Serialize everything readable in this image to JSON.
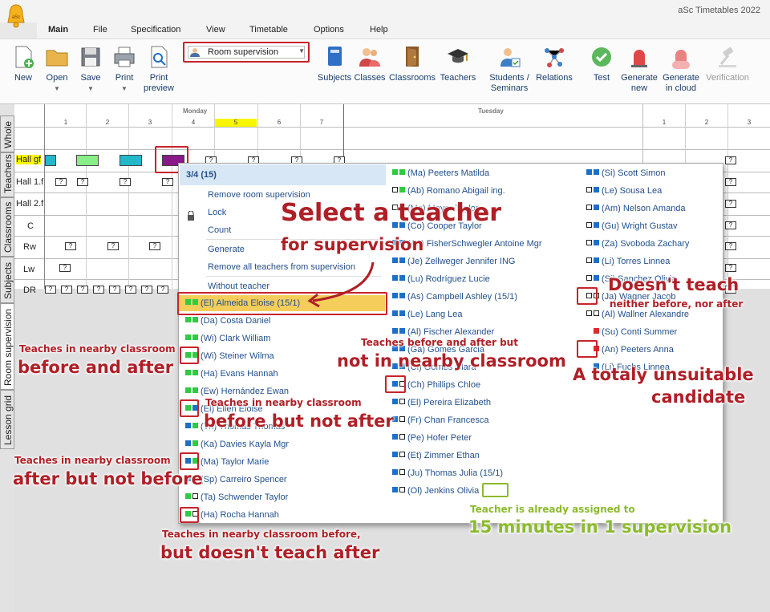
{
  "app": {
    "title": "aSc Timetables 2022"
  },
  "menu": [
    "Main",
    "File",
    "Specification",
    "View",
    "Timetable",
    "Options",
    "Help"
  ],
  "ribbon": {
    "new": "New",
    "open": "Open",
    "save": "Save",
    "print": "Print",
    "print_preview_1": "Print",
    "print_preview_2": "preview",
    "mode_select": "Room supervision",
    "subjects": "Subjects",
    "classes": "Classes",
    "classrooms": "Classrooms",
    "teachers": "Teachers",
    "students_1": "Students /",
    "students_2": "Seminars",
    "relations": "Relations",
    "test": "Test",
    "generate_1": "Generate",
    "generate_2": "new",
    "generate_cloud_1": "Generate",
    "generate_cloud_2": "in cloud",
    "verification": "Verification"
  },
  "vtabs": [
    "Whole",
    "Teachers",
    "Classrooms",
    "Subjects",
    "Room supervision",
    "Lesson grid"
  ],
  "grid": {
    "days": [
      "Monday",
      "Tuesday"
    ],
    "periods": [
      "1",
      "2",
      "3",
      "4",
      "5",
      "6",
      "7",
      "1",
      "2",
      "3"
    ],
    "rows": [
      "Hall gf",
      "Hall 1.f",
      "Hall 2.f",
      "C",
      "Rw",
      "Lw",
      "DR"
    ],
    "cell_mark": "?",
    "cell_colors": [
      "#22b8c8",
      "#88ee88",
      "#22b8c8",
      "#8a188a"
    ]
  },
  "menu_popup": {
    "header": "3/4 (15)",
    "items": [
      "Remove room supervision",
      "Lock",
      "Count",
      "Generate",
      "Remove all teachers from supervision",
      "Without teacher"
    ]
  },
  "teachers_col1": [
    "(El) Almeida Eloise (15/1)",
    "(Da) Costa Daniel",
    "(Wi) Clark William",
    "(Wi) Steiner Wilma",
    "(Ha) Evans Hannah",
    "(Ew) Hernández Ewan",
    "(El) Ellen Eloise",
    "(Th) Thomas Thomas",
    "(Ka) Davies Kayla Mgr",
    "(Ma) Taylor Marie",
    "(Sp) Carreiro Spencer",
    "(Ta) Schwender Taylor",
    "(Ha) Rocha Hannah"
  ],
  "teachers_col2": [
    "(Ma) Peeters Matilda",
    "(Ab) Romano Abigail ing.",
    "(Ma) Mayer Taylor",
    "(Co) Cooper Taylor",
    "(An) FisherSchwegler Antoine Mgr",
    "(Je) Zellweger Jennifer ING",
    "(Lu) Rodríguez Lucie",
    "(As) Campbell Ashley (15/1)",
    "(Le) Lang Lea",
    "(Al) Fischer Alexander",
    "(Ga) Gomes Garcia",
    "(Cl) Gomes Clara",
    "(Ch) Phillips Chloe",
    "(El) Pereira Elizabeth",
    "(Fr) Chan Francesca",
    "(Pe) Hofer Peter",
    "(Et) Zimmer Ethan",
    "(Ju) Thomas Julia (15/1)",
    "(Ol) Jenkins Olivia"
  ],
  "teachers_col3": [
    "(Si) Scott Simon",
    "(Le) Sousa Lea",
    "(Am) Nelson Amanda",
    "(Gu) Wright Gustav",
    "(Za) Svoboda Zachary",
    "(Li) Torres Linnea",
    "(Si) Sanchez Olivia",
    "(Ja) Wagner Jacob",
    "(Al) Wallner Alexandre",
    "(Su) Conti Summer",
    "(An) Peeters Anna",
    "(Li) Fuchs Linnea"
  ],
  "annotations": {
    "select_1": "Select a teacher",
    "select_2": "for supervision",
    "both_1": "Teaches in nearby classroom",
    "both_2": "before and after",
    "before_not_after_1": "Teaches in nearby classroom",
    "before_not_after_2": "before but not after",
    "after_not_before_1": "Teaches in nearby classroom",
    "after_not_before_2": "after but not before",
    "before_not_teach_after_1": "Teaches in nearby classroom before,",
    "before_not_teach_after_2": "but doesn't teach after",
    "not_nearby_1": "Teaches before and after but",
    "not_nearby_2": "not in nearby classroom",
    "doesnt_teach_1": "Doesn't teach",
    "doesnt_teach_2": "neither before, nor after",
    "unsuitable_1": "A totaly unsuitable",
    "unsuitable_2": "candidate",
    "assigned_1": "Teacher is already assigned to",
    "assigned_2": "15 minutes in 1 supervision"
  }
}
